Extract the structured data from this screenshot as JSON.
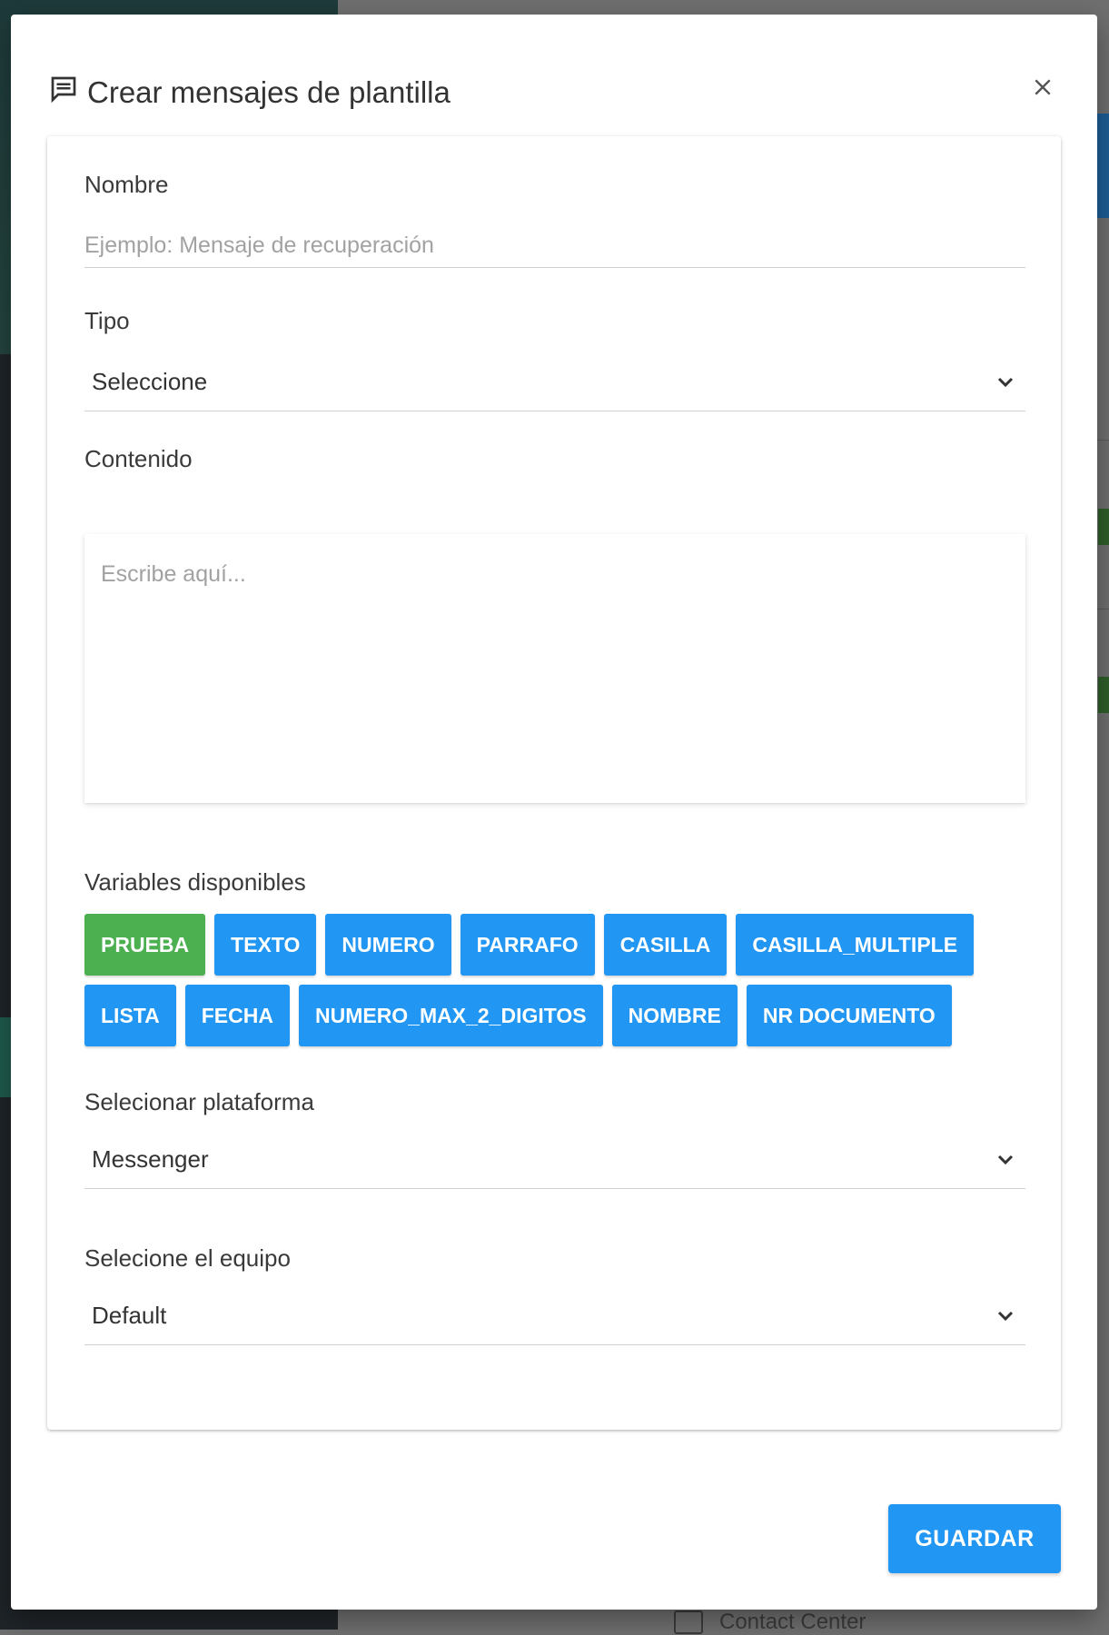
{
  "dialog": {
    "title": "Crear mensajes de plantilla",
    "close_glyph": "×",
    "save_label": "GUARDAR"
  },
  "form": {
    "nombre": {
      "label": "Nombre",
      "placeholder": "Ejemplo: Mensaje de recuperación"
    },
    "tipo": {
      "label": "Tipo",
      "value": "Seleccione"
    },
    "contenido": {
      "label": "Contenido",
      "placeholder": "Escribe aquí..."
    },
    "variables": {
      "label": "Variables disponibles",
      "row1": [
        "PRUEBA",
        "TEXTO",
        "NUMERO",
        "PARRAFO",
        "CASILLA",
        "CASILLA_MULTIPLE"
      ],
      "row2": [
        "LISTA",
        "FECHA",
        "NUMERO_MAX_2_DIGITOS",
        "NOMBRE",
        "NR DOCUMENTO"
      ]
    },
    "plataforma": {
      "label": "Selecionar plataforma",
      "value": "Messenger"
    },
    "equipo": {
      "label": "Selecione el equipo",
      "value": "Default"
    }
  },
  "background": {
    "footer_label": "Contact Center"
  },
  "colors": {
    "primary": "#2196f3",
    "success": "#4caf50"
  },
  "icons": {
    "title": "chat-message-icon",
    "close": "close-icon",
    "select": "chevron-down-icon"
  }
}
